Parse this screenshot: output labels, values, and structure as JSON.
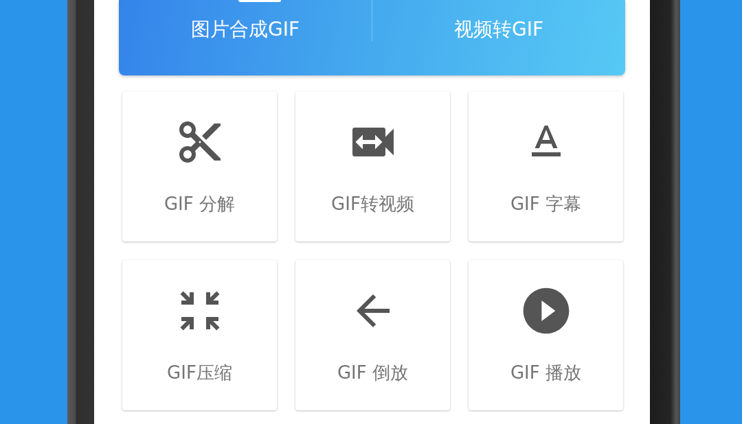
{
  "modes": [
    {
      "label": "图片合成GIF"
    },
    {
      "label": "视频转GIF"
    }
  ],
  "tools": [
    {
      "label": "GIF 分解",
      "kind": "cut"
    },
    {
      "label": "GIF转视频",
      "kind": "video"
    },
    {
      "label": "GIF 字幕",
      "kind": "text"
    },
    {
      "label": "GIF压缩",
      "kind": "compress"
    },
    {
      "label": "GIF 倒放",
      "kind": "back"
    },
    {
      "label": "GIF 播放",
      "kind": "play"
    }
  ]
}
